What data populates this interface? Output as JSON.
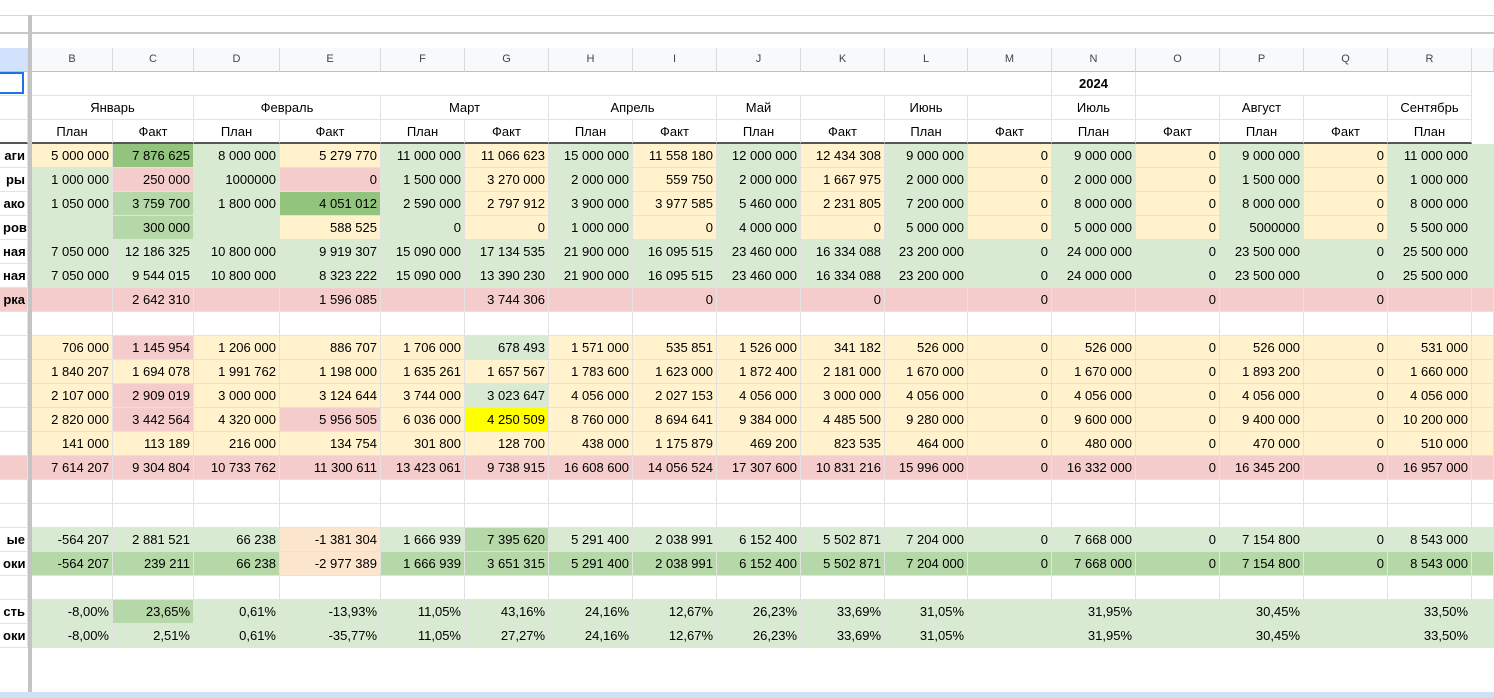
{
  "columns": [
    "B",
    "C",
    "D",
    "E",
    "F",
    "G",
    "H",
    "I",
    "J",
    "K",
    "L",
    "M",
    "N",
    "O",
    "P",
    "Q",
    "R"
  ],
  "year": "2024",
  "months": [
    "Январь",
    "Февраль",
    "Март",
    "Апрель",
    "Май",
    "Июнь",
    "Июль",
    "Август",
    "Сентябрь"
  ],
  "sub": {
    "plan": "План",
    "fact": "Факт"
  },
  "rows": [
    {
      "label": "аги",
      "vals": [
        "5 000 000",
        "7 876 625",
        "8 000 000",
        "5 279 770",
        "11 000 000",
        "11 066 623",
        "15 000 000",
        "11 558 180",
        "12 000 000",
        "12 434 308",
        "9 000 000",
        "0",
        "9 000 000",
        "0",
        "9 000 000",
        "0",
        "11 000 000"
      ],
      "colors": [
        "Y",
        "DG",
        "G",
        "Y",
        "G",
        "Y",
        "G",
        "Y",
        "G",
        "Y",
        "G",
        "Y",
        "G",
        "Y",
        "G",
        "Y",
        "G"
      ]
    },
    {
      "label": "ры",
      "vals": [
        "1 000 000",
        "250 000",
        "1000000",
        "0",
        "1 500 000",
        "3 270 000",
        "2 000 000",
        "559 750",
        "2 000 000",
        "1 667 975",
        "2 000 000",
        "0",
        "2 000 000",
        "0",
        "1 500 000",
        "0",
        "1 000 000"
      ],
      "colors": [
        "G",
        "P",
        "G",
        "P",
        "G",
        "Y",
        "G",
        "Y",
        "G",
        "Y",
        "G",
        "Y",
        "G",
        "Y",
        "G",
        "Y",
        "G"
      ]
    },
    {
      "label": "ако",
      "vals": [
        "1 050 000",
        "3 759 700",
        "1 800 000",
        "4 051 012",
        "2 590 000",
        "2 797 912",
        "3 900 000",
        "3 977 585",
        "5 460 000",
        "2 231 805",
        "7 200 000",
        "0",
        "8 000 000",
        "0",
        "8 000 000",
        "0",
        "8 000 000"
      ],
      "colors": [
        "G",
        "GG",
        "G",
        "DG",
        "G",
        "Y",
        "G",
        "Y",
        "G",
        "Y",
        "G",
        "Y",
        "G",
        "Y",
        "G",
        "Y",
        "G"
      ]
    },
    {
      "label": "ров",
      "vals": [
        "",
        "300 000",
        "",
        "588 525",
        "0",
        "0",
        "1 000 000",
        "0",
        "4 000 000",
        "0",
        "5 000 000",
        "0",
        "5 000 000",
        "0",
        "5000000",
        "0",
        "5 500 000"
      ],
      "colors": [
        "G",
        "GG",
        "G",
        "Y",
        "G",
        "Y",
        "G",
        "Y",
        "G",
        "Y",
        "G",
        "Y",
        "G",
        "Y",
        "G",
        "Y",
        "G"
      ]
    },
    {
      "label": "ная",
      "vals": [
        "7 050 000",
        "12 186 325",
        "10 800 000",
        "9 919 307",
        "15 090 000",
        "17 134 535",
        "21 900 000",
        "16 095 515",
        "23 460 000",
        "16 334 088",
        "23 200 000",
        "0",
        "24 000 000",
        "0",
        "23 500 000",
        "0",
        "25 500 000"
      ],
      "colors": [
        "G",
        "G",
        "G",
        "G",
        "G",
        "G",
        "G",
        "G",
        "G",
        "G",
        "G",
        "G",
        "G",
        "G",
        "G",
        "G",
        "G"
      ]
    },
    {
      "label": "ная",
      "vals": [
        "7 050 000",
        "9 544 015",
        "10 800 000",
        "8 323 222",
        "15 090 000",
        "13 390 230",
        "21 900 000",
        "16 095 515",
        "23 460 000",
        "16 334 088",
        "23 200 000",
        "0",
        "24 000 000",
        "0",
        "23 500 000",
        "0",
        "25 500 000"
      ],
      "colors": [
        "G",
        "G",
        "G",
        "G",
        "G",
        "G",
        "G",
        "G",
        "G",
        "G",
        "G",
        "G",
        "G",
        "G",
        "G",
        "G",
        "G"
      ]
    },
    {
      "label": "рка",
      "vals": [
        "",
        "2 642 310",
        "",
        "1 596 085",
        "",
        "3 744 306",
        "",
        "0",
        "",
        "0",
        "",
        "0",
        "",
        "0",
        "",
        "0",
        ""
      ],
      "colors": [
        "P",
        "P",
        "P",
        "P",
        "P",
        "P",
        "P",
        "P",
        "P",
        "P",
        "P",
        "P",
        "P",
        "P",
        "P",
        "P",
        "P"
      ]
    },
    {
      "label": "",
      "vals": [
        "",
        "",
        "",
        "",
        "",
        "",
        "",
        "",
        "",
        "",
        "",
        "",
        "",
        "",
        "",
        "",
        ""
      ],
      "colors": [
        "",
        "",
        "",
        "",
        "",
        "",
        "",
        "",
        "",
        "",
        "",
        "",
        "",
        "",
        "",
        "",
        ""
      ]
    },
    {
      "label": "",
      "vals": [
        "706 000",
        "1 145 954",
        "1 206 000",
        "886 707",
        "1 706 000",
        "678 493",
        "1 571 000",
        "535 851",
        "1 526 000",
        "341 182",
        "526 000",
        "0",
        "526 000",
        "0",
        "526 000",
        "0",
        "531 000"
      ],
      "colors": [
        "Y",
        "P",
        "Y",
        "Y",
        "Y",
        "G",
        "Y",
        "Y",
        "Y",
        "Y",
        "Y",
        "Y",
        "Y",
        "Y",
        "Y",
        "Y",
        "Y"
      ]
    },
    {
      "label": "",
      "vals": [
        "1 840 207",
        "1 694 078",
        "1 991 762",
        "1 198 000",
        "1 635 261",
        "1 657 567",
        "1 783 600",
        "1 623 000",
        "1 872 400",
        "2 181 000",
        "1 670 000",
        "0",
        "1 670 000",
        "0",
        "1 893 200",
        "0",
        "1 660 000"
      ],
      "colors": [
        "Y",
        "Y",
        "Y",
        "Y",
        "Y",
        "Y",
        "Y",
        "Y",
        "Y",
        "Y",
        "Y",
        "Y",
        "Y",
        "Y",
        "Y",
        "Y",
        "Y"
      ]
    },
    {
      "label": "",
      "vals": [
        "2 107 000",
        "2 909 019",
        "3 000 000",
        "3 124 644",
        "3 744 000",
        "3 023 647",
        "4 056 000",
        "2 027 153",
        "4 056 000",
        "3 000 000",
        "4 056 000",
        "0",
        "4 056 000",
        "0",
        "4 056 000",
        "0",
        "4 056 000"
      ],
      "colors": [
        "Y",
        "P",
        "Y",
        "Y",
        "Y",
        "G",
        "Y",
        "Y",
        "Y",
        "Y",
        "Y",
        "Y",
        "Y",
        "Y",
        "Y",
        "Y",
        "Y"
      ]
    },
    {
      "label": "",
      "vals": [
        "2 820 000",
        "3 442 564",
        "4 320 000",
        "5 956 505",
        "6 036 000",
        "4 250 509",
        "8 760 000",
        "8 694 641",
        "9 384 000",
        "4 485 500",
        "9 280 000",
        "0",
        "9 600 000",
        "0",
        "9 400 000",
        "0",
        "10 200 000"
      ],
      "colors": [
        "Y",
        "P",
        "Y",
        "P",
        "Y",
        "YY",
        "Y",
        "Y",
        "Y",
        "Y",
        "Y",
        "Y",
        "Y",
        "Y",
        "Y",
        "Y",
        "Y"
      ]
    },
    {
      "label": "",
      "vals": [
        "141 000",
        "113 189",
        "216 000",
        "134 754",
        "301 800",
        "128 700",
        "438 000",
        "1 175 879",
        "469 200",
        "823 535",
        "464 000",
        "0",
        "480 000",
        "0",
        "470 000",
        "0",
        "510 000"
      ],
      "colors": [
        "Y",
        "Y",
        "Y",
        "Y",
        "Y",
        "Y",
        "Y",
        "Y",
        "Y",
        "Y",
        "Y",
        "Y",
        "Y",
        "Y",
        "Y",
        "Y",
        "Y"
      ]
    },
    {
      "label": "",
      "vals": [
        "7 614 207",
        "9 304 804",
        "10 733 762",
        "11 300 611",
        "13 423 061",
        "9 738 915",
        "16 608 600",
        "14 056 524",
        "17 307 600",
        "10 831 216",
        "15 996 000",
        "0",
        "16 332 000",
        "0",
        "16 345 200",
        "0",
        "16 957 000"
      ],
      "colors": [
        "P",
        "P",
        "P",
        "P",
        "P",
        "P",
        "P",
        "P",
        "P",
        "P",
        "P",
        "P",
        "P",
        "P",
        "P",
        "P",
        "P"
      ]
    },
    {
      "label": "",
      "vals": [
        "",
        "",
        "",
        "",
        "",
        "",
        "",
        "",
        "",
        "",
        "",
        "",
        "",
        "",
        "",
        "",
        ""
      ],
      "colors": [
        "",
        "",
        "",
        "",
        "",
        "",
        "",
        "",
        "",
        "",
        "",
        "",
        "",
        "",
        "",
        "",
        ""
      ]
    },
    {
      "label": "",
      "vals": [
        "",
        "",
        "",
        "",
        "",
        "",
        "",
        "",
        "",
        "",
        "",
        "",
        "",
        "",
        "",
        "",
        ""
      ],
      "colors": [
        "",
        "",
        "",
        "",
        "",
        "",
        "",
        "",
        "",
        "",
        "",
        "",
        "",
        "",
        "",
        "",
        ""
      ]
    },
    {
      "label": "ые",
      "vals": [
        "-564 207",
        "2 881 521",
        "66 238",
        "-1 381 304",
        "1 666 939",
        "7 395 620",
        "5 291 400",
        "2 038 991",
        "6 152 400",
        "5 502 871",
        "7 204 000",
        "0",
        "7 668 000",
        "0",
        "7 154 800",
        "0",
        "8 543 000"
      ],
      "colors": [
        "G",
        "G",
        "G",
        "O",
        "G",
        "GG",
        "G",
        "G",
        "G",
        "G",
        "G",
        "G",
        "G",
        "G",
        "G",
        "G",
        "G"
      ]
    },
    {
      "label": "оки",
      "vals": [
        "-564 207",
        "239 211",
        "66 238",
        "-2 977 389",
        "1 666 939",
        "3 651 315",
        "5 291 400",
        "2 038 991",
        "6 152 400",
        "5 502 871",
        "7 204 000",
        "0",
        "7 668 000",
        "0",
        "7 154 800",
        "0",
        "8 543 000"
      ],
      "colors": [
        "GG",
        "GG",
        "GG",
        "O",
        "GG",
        "GG",
        "GG",
        "GG",
        "GG",
        "GG",
        "GG",
        "GG",
        "GG",
        "GG",
        "GG",
        "GG",
        "GG"
      ]
    },
    {
      "label": "",
      "vals": [
        "",
        "",
        "",
        "",
        "",
        "",
        "",
        "",
        "",
        "",
        "",
        "",
        "",
        "",
        "",
        "",
        ""
      ],
      "colors": [
        "",
        "",
        "",
        "",
        "",
        "",
        "",
        "",
        "",
        "",
        "",
        "",
        "",
        "",
        "",
        "",
        ""
      ]
    },
    {
      "label": "сть",
      "vals": [
        "-8,00%",
        "23,65%",
        "0,61%",
        "-13,93%",
        "11,05%",
        "43,16%",
        "24,16%",
        "12,67%",
        "26,23%",
        "33,69%",
        "31,05%",
        "",
        "31,95%",
        "",
        "30,45%",
        "",
        "33,50%"
      ],
      "colors": [
        "G",
        "GG",
        "G",
        "G",
        "G",
        "G",
        "G",
        "G",
        "G",
        "G",
        "G",
        "G",
        "G",
        "G",
        "G",
        "G",
        "G"
      ]
    },
    {
      "label": "оки",
      "vals": [
        "-8,00%",
        "2,51%",
        "0,61%",
        "-35,77%",
        "11,05%",
        "27,27%",
        "24,16%",
        "12,67%",
        "26,23%",
        "33,69%",
        "31,05%",
        "",
        "31,95%",
        "",
        "30,45%",
        "",
        "33,50%"
      ],
      "colors": [
        "G",
        "G",
        "G",
        "G",
        "G",
        "G",
        "G",
        "G",
        "G",
        "G",
        "G",
        "G",
        "G",
        "G",
        "G",
        "G",
        "G"
      ]
    }
  ],
  "accents": {
    "yellow": "#fff2cc",
    "green": "#d9ead3",
    "green2": "#b6d7a8",
    "green3": "#93c47d",
    "pink": "#f4cccc",
    "orange": "#fce5cd",
    "highlight": "#ffff00"
  }
}
